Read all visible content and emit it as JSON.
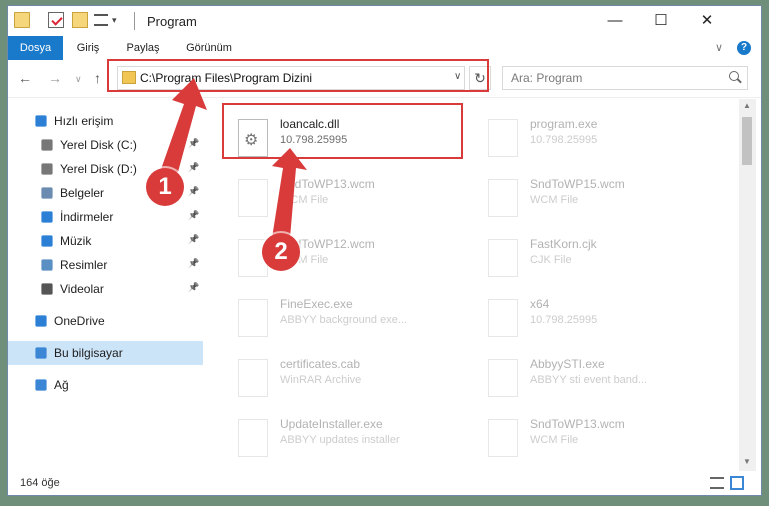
{
  "window": {
    "title": "Program"
  },
  "ribbon": {
    "tabs": [
      "Dosya",
      "Giriş",
      "Paylaş",
      "Görünüm"
    ],
    "help": "?"
  },
  "address": {
    "path": "C:\\Program Files\\Program Dizini",
    "search_placeholder": "Ara: Program"
  },
  "sidebar": {
    "items": [
      {
        "label": "Hızlı erişim",
        "icon": "star-icon"
      },
      {
        "label": "Yerel Disk (C:)",
        "icon": "drive-icon",
        "pinned": true
      },
      {
        "label": "Yerel Disk (D:)",
        "icon": "drive-icon",
        "pinned": true
      },
      {
        "label": "Belgeler",
        "icon": "documents-icon",
        "pinned": true
      },
      {
        "label": "İndirmeler",
        "icon": "download-icon",
        "pinned": true
      },
      {
        "label": "Müzik",
        "icon": "music-icon",
        "pinned": true
      },
      {
        "label": "Resimler",
        "icon": "pictures-icon",
        "pinned": true
      },
      {
        "label": "Videolar",
        "icon": "videos-icon",
        "pinned": true
      },
      {
        "label": "OneDrive",
        "icon": "cloud-icon"
      },
      {
        "label": "Bu bilgisayar",
        "icon": "computer-icon",
        "selected": true
      },
      {
        "label": "Ağ",
        "icon": "network-icon"
      }
    ]
  },
  "files": [
    {
      "name": "loancalc.dll",
      "sub": "10.798.25995",
      "selected": true
    },
    {
      "name": "program.exe",
      "sub": "10.798.25995"
    },
    {
      "name": "SndToWP13.wcm",
      "sub": "WCM File"
    },
    {
      "name": "SndToWP15.wcm",
      "sub": "WCM File"
    },
    {
      "name": "SndToWP12.wcm",
      "sub": "WCM File"
    },
    {
      "name": "FastKorn.cjk",
      "sub": "CJK File"
    },
    {
      "name": "FineExec.exe",
      "sub": "ABBYY background exe..."
    },
    {
      "name": "x64",
      "sub": "10.798.25995"
    },
    {
      "name": "certificates.cab",
      "sub": "WinRAR Archive"
    },
    {
      "name": "AbbyySTI.exe",
      "sub": "ABBYY sti event band..."
    },
    {
      "name": "UpdateInstaller.exe",
      "sub": "ABBYY updates installer"
    },
    {
      "name": "SndToWP13.wcm",
      "sub": "WCM File"
    }
  ],
  "status": {
    "count": "164 öğe"
  },
  "callouts": [
    "1",
    "2"
  ],
  "colors": {
    "accent": "#1979ca",
    "highlight": "#d93a3a",
    "selected_bg": "#cce4f7"
  }
}
